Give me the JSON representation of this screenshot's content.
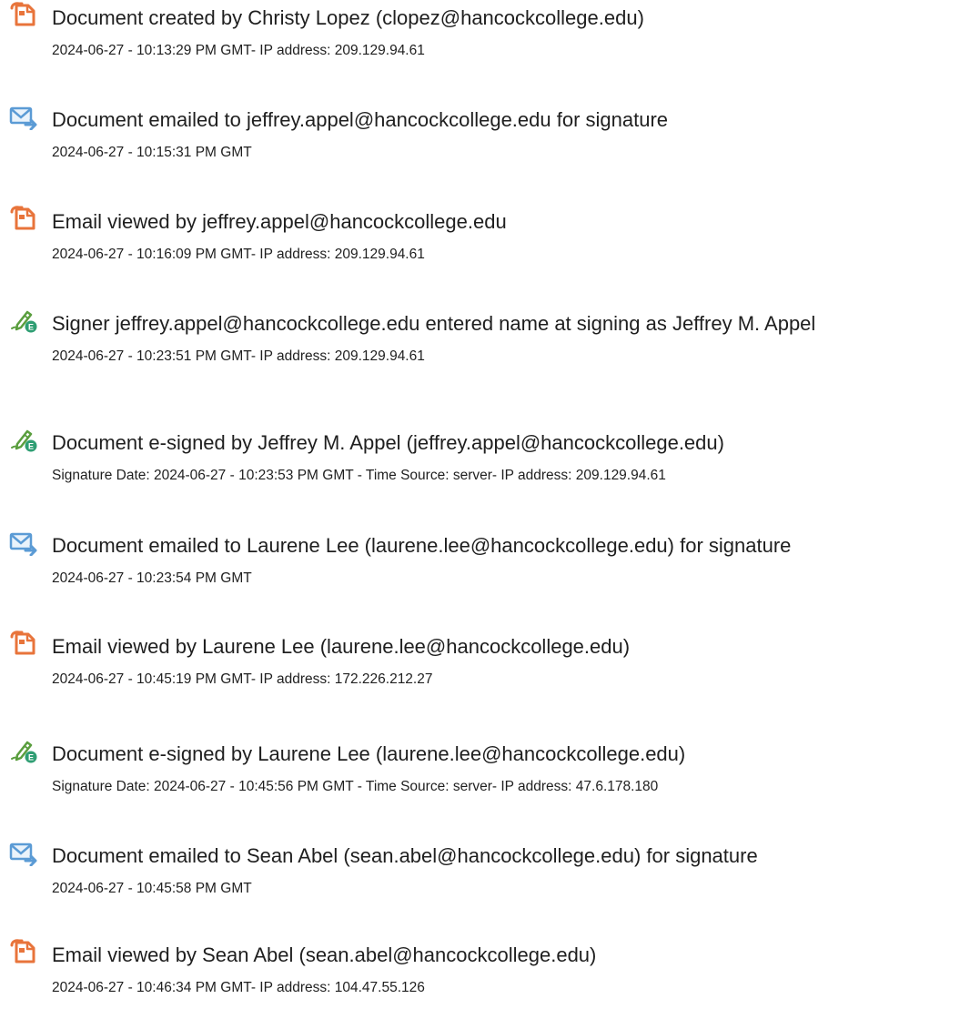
{
  "audit_log": {
    "entries": [
      {
        "icon": "document-created-icon",
        "title": "Document created by Christy Lopez (clopez@hancockcollege.edu)",
        "detail": "2024-06-27 - 10:13:29 PM GMT- IP address: 209.129.94.61"
      },
      {
        "icon": "email-sent-icon",
        "title": "Document emailed to jeffrey.appel@hancockcollege.edu for signature",
        "detail": "2024-06-27 - 10:15:31 PM GMT"
      },
      {
        "icon": "document-viewed-icon",
        "title": "Email viewed by jeffrey.appel@hancockcollege.edu",
        "detail": "2024-06-27 - 10:16:09 PM GMT- IP address: 209.129.94.61"
      },
      {
        "icon": "e-sign-pen-icon",
        "title": "Signer jeffrey.appel@hancockcollege.edu entered name at signing as Jeffrey M. Appel",
        "detail": "2024-06-27 - 10:23:51 PM GMT- IP address: 209.129.94.61"
      },
      {
        "icon": "e-sign-pen-icon",
        "title": "Document e-signed by Jeffrey M. Appel (jeffrey.appel@hancockcollege.edu)",
        "detail": "Signature Date: 2024-06-27 - 10:23:53 PM GMT - Time Source: server- IP address: 209.129.94.61"
      },
      {
        "icon": "email-sent-icon",
        "title": "Document emailed to Laurene Lee (laurene.lee@hancockcollege.edu) for signature",
        "detail": "2024-06-27 - 10:23:54 PM GMT"
      },
      {
        "icon": "document-viewed-icon",
        "title": "Email viewed by Laurene Lee (laurene.lee@hancockcollege.edu)",
        "detail": "2024-06-27 - 10:45:19 PM GMT- IP address: 172.226.212.27"
      },
      {
        "icon": "e-sign-pen-icon",
        "title": "Document e-signed by Laurene Lee (laurene.lee@hancockcollege.edu)",
        "detail": "Signature Date: 2024-06-27 - 10:45:56 PM GMT - Time Source: server- IP address: 47.6.178.180"
      },
      {
        "icon": "email-sent-icon",
        "title": "Document emailed to Sean Abel (sean.abel@hancockcollege.edu) for signature",
        "detail": "2024-06-27 - 10:45:58 PM GMT"
      },
      {
        "icon": "document-viewed-icon",
        "title": "Email viewed by Sean Abel (sean.abel@hancockcollege.edu)",
        "detail": "2024-06-27 - 10:46:34 PM GMT- IP address: 104.47.55.126"
      }
    ]
  },
  "colors": {
    "document_icon": "#e8743b",
    "email_icon": "#5b9bd5",
    "pen_icon": "#5a9e3e",
    "badge_icon": "#2f9e73",
    "text": "#1f1f1f"
  }
}
